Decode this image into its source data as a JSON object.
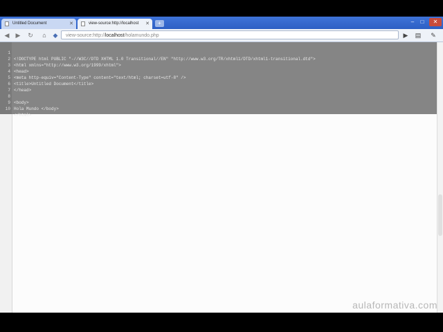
{
  "browser": {
    "tabs": [
      {
        "label": "Untitled Document",
        "active": false
      },
      {
        "label": "view-source:http://localhost",
        "active": true
      }
    ],
    "address": {
      "prefix": "view-source:http://",
      "host": "localhost",
      "path": "/holamundo.php"
    }
  },
  "source": {
    "lines": [
      {
        "num": "1",
        "text": "<!DOCTYPE html PUBLIC \"-//W3C//DTD XHTML 1.0 Transitional//EN\" \"http://www.w3.org/TR/xhtml1/DTD/xhtml1-transitional.dtd\">"
      },
      {
        "num": "2",
        "text": "<html xmlns=\"http://www.w3.org/1999/xhtml\">"
      },
      {
        "num": "3",
        "text": "<head>"
      },
      {
        "num": "4",
        "text": "<meta http-equiv=\"Content-Type\" content=\"text/html; charset=utf-8\" />"
      },
      {
        "num": "5",
        "text": "<title>Untitled Document</title>"
      },
      {
        "num": "6",
        "text": "</head>"
      },
      {
        "num": "7",
        "text": ""
      },
      {
        "num": "8",
        "text": "<body>"
      },
      {
        "num": "9",
        "text": "Hola Mundo </body>"
      },
      {
        "num": "10",
        "text": "</html>"
      }
    ]
  },
  "watermark": "aulaformativa.com"
}
